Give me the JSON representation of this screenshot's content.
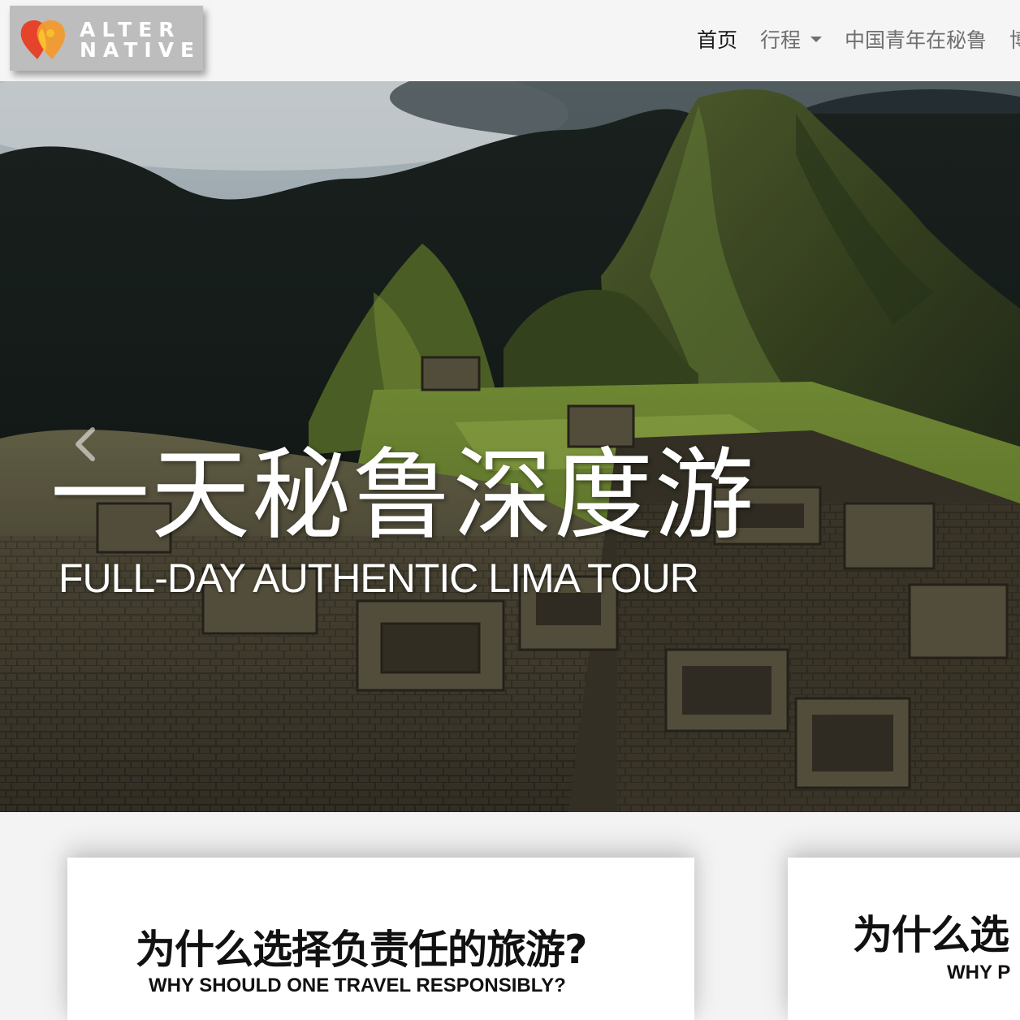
{
  "logo": {
    "line1": "ALTER",
    "line2": "NATIVE",
    "colors": {
      "red": "#e5432b",
      "orange": "#f29a2e",
      "yellow": "#f7c22e",
      "plate": "#bdbdbd"
    }
  },
  "nav": {
    "items": [
      {
        "label": "首页",
        "active": true
      },
      {
        "label": "行程",
        "dropdown": true
      },
      {
        "label": "中国青年在秘鲁"
      },
      {
        "label": "博"
      }
    ]
  },
  "hero": {
    "title": "一天秘鲁深度游",
    "subtitle": "FULL-DAY AUTHENTIC LIMA TOUR",
    "prev_icon": "chevron-left-icon"
  },
  "cards": [
    {
      "title": "为什么选择负责任的旅游?",
      "subtitle": "WHY SHOULD ONE TRAVEL RESPONSIBLY?"
    },
    {
      "title": "为什么选",
      "subtitle": "WHY P"
    }
  ],
  "colors": {
    "page_bg": "#f3f3f3",
    "header_bg": "#f5f5f5",
    "nav_text": "#6f6f6f",
    "nav_active": "#1a1a1a"
  }
}
